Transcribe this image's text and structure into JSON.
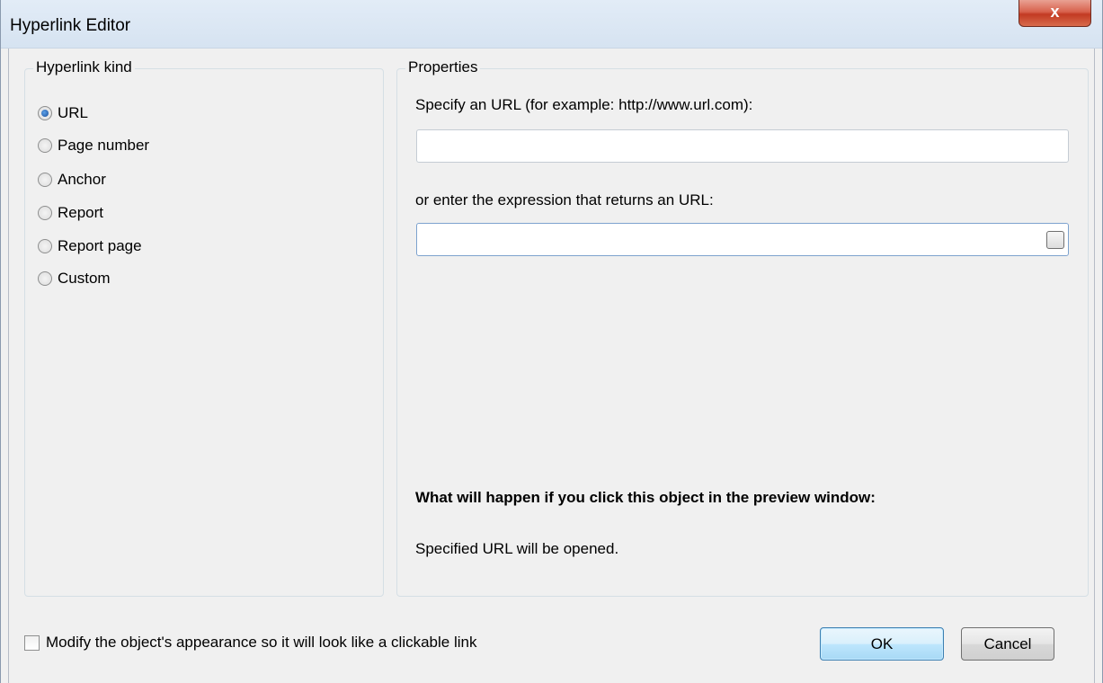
{
  "window": {
    "title": "Hyperlink Editor",
    "close_glyph": "x"
  },
  "kind_group": {
    "legend": "Hyperlink kind",
    "options": [
      {
        "label": "URL",
        "checked": true
      },
      {
        "label": "Page number",
        "checked": false
      },
      {
        "label": "Anchor",
        "checked": false
      },
      {
        "label": "Report",
        "checked": false
      },
      {
        "label": "Report page",
        "checked": false
      },
      {
        "label": "Custom",
        "checked": false
      }
    ]
  },
  "properties": {
    "legend": "Properties",
    "url_label": "Specify an URL (for example: http://www.url.com):",
    "url_value": "",
    "expression_label": "or enter the expression that returns an URL:",
    "expression_value": "",
    "what_happens_heading": "What will happen if you click this object in the preview window:",
    "what_happens_text": "Specified URL will be opened."
  },
  "footer": {
    "appearance_checkbox_label": "Modify the object's appearance so it will look like a clickable link",
    "appearance_checked": false,
    "ok_label": "OK",
    "cancel_label": "Cancel"
  }
}
